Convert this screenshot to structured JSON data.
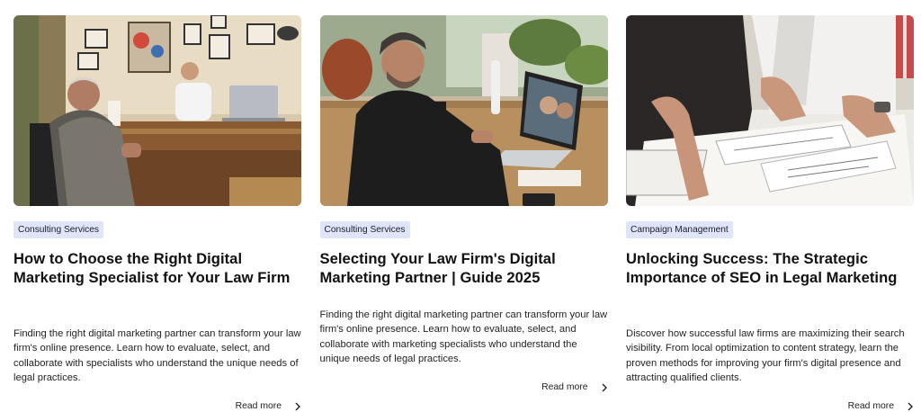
{
  "cards": [
    {
      "image": "Older man in a plaid jacket seated across a desk from a younger man in an office with framed pictures",
      "tag": "Consulting Services",
      "title": "How to Choose the Right Digital Marketing Specialist for Your Law Firm",
      "excerpt": "Finding the right digital marketing partner can transform your law firm's online presence. Learn how to evaluate, select, and collaborate with specialists who understand the unique needs of legal practices.",
      "read_more": "Read more"
    },
    {
      "image": "Man in a black shirt on a video call on a laptop at a wooden table",
      "tag": "Consulting Services",
      "title": "Selecting Your Law Firm's Digital Marketing Partner | Guide 2025",
      "excerpt": "Finding the right digital marketing partner can transform your law firm's online presence. Learn how to evaluate, select, and collaborate with marketing specialists who understand the unique needs of legal practices.",
      "read_more": "Read more"
    },
    {
      "image": "Two people pointing at charts and documents spread on a white table",
      "tag": "Campaign Management",
      "title": "Unlocking Success: The Strategic Importance of SEO in Legal Marketing",
      "excerpt": "Discover how successful law firms are maximizing their search visibility. From local optimization to content strategy, learn the proven methods for improving your firm's digital presence and attracting qualified clients.",
      "read_more": "Read more"
    }
  ],
  "colors": {
    "tag_bg": "#dfe6fb",
    "title": "#111111",
    "text": "#232323"
  },
  "icons": {
    "read_more": "chevron-right-icon"
  }
}
